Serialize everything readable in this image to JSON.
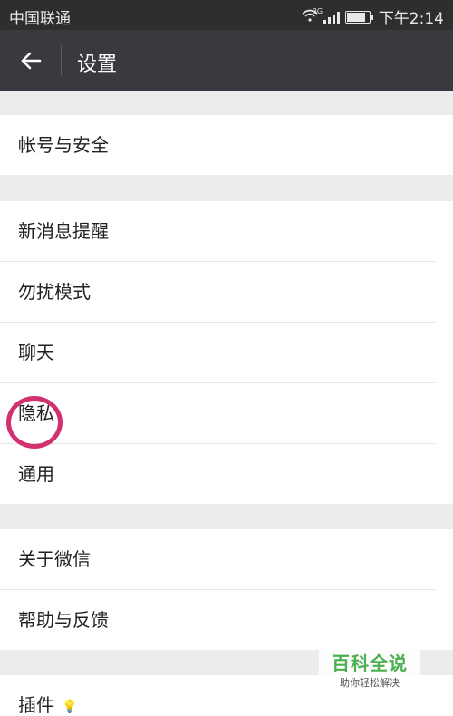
{
  "status": {
    "carrier": "中国联通",
    "network": "3G",
    "time": "下午2:14",
    "battery_level": 0.9
  },
  "header": {
    "title": "设置"
  },
  "groups": [
    {
      "items": [
        "帐号与安全"
      ]
    },
    {
      "items": [
        "新消息提醒",
        "勿扰模式",
        "聊天",
        "隐私",
        "通用"
      ]
    },
    {
      "items": [
        "关于微信",
        "帮助与反馈"
      ]
    },
    {
      "items": [
        "插件"
      ]
    }
  ],
  "annotation": {
    "color": "#d1326f"
  },
  "watermark": {
    "title": "百科全说",
    "subtitle": "助你轻松解决"
  }
}
